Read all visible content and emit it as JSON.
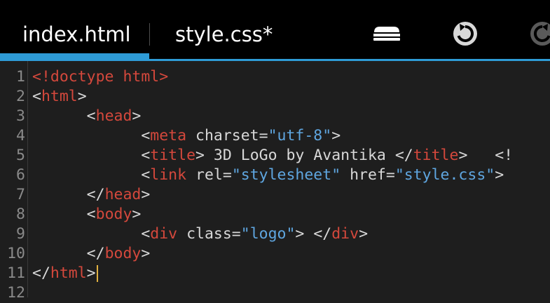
{
  "tabs": [
    {
      "label": "index.html",
      "active": true
    },
    {
      "label": "style.css*",
      "active": false
    }
  ],
  "toolbar": {
    "icons": [
      "menu-icon",
      "undo-icon",
      "redo-icon"
    ]
  },
  "colors": {
    "accent": "#2e9bd6",
    "tag": "#d4483c",
    "string": "#5fa6e0",
    "text": "#d8d8d8",
    "gutter_text": "#8a8a8a",
    "cursor": "#e0b040"
  },
  "editor": {
    "line_numbers": [
      "1",
      "2",
      "3",
      "4",
      "5",
      "6",
      "7",
      "8",
      "9",
      "10",
      "11",
      "12"
    ],
    "lines": [
      {
        "indent": "",
        "tokens": [
          {
            "type": "doctype",
            "text": "<!doctype html>"
          }
        ]
      },
      {
        "indent": "",
        "tokens": [
          {
            "type": "bracket",
            "text": "<"
          },
          {
            "type": "tag",
            "text": "html"
          },
          {
            "type": "bracket",
            "text": ">"
          }
        ]
      },
      {
        "indent": "      ",
        "tokens": [
          {
            "type": "bracket",
            "text": "<"
          },
          {
            "type": "tag",
            "text": "head"
          },
          {
            "type": "bracket",
            "text": ">"
          }
        ]
      },
      {
        "indent": "            ",
        "tokens": [
          {
            "type": "bracket",
            "text": "<"
          },
          {
            "type": "tag",
            "text": "meta"
          },
          {
            "type": "attr",
            "text": " charset="
          },
          {
            "type": "str",
            "text": "\"utf-8\""
          },
          {
            "type": "bracket",
            "text": ">"
          }
        ]
      },
      {
        "indent": "            ",
        "tokens": [
          {
            "type": "bracket",
            "text": "<"
          },
          {
            "type": "tag",
            "text": "title"
          },
          {
            "type": "bracket",
            "text": ">"
          },
          {
            "type": "text",
            "text": " 3D LoGo by Avantika "
          },
          {
            "type": "bracket",
            "text": "</"
          },
          {
            "type": "tag",
            "text": "title"
          },
          {
            "type": "bracket",
            "text": ">"
          },
          {
            "type": "text",
            "text": "   "
          },
          {
            "type": "bracket",
            "text": "<!"
          }
        ]
      },
      {
        "indent": "            ",
        "tokens": [
          {
            "type": "bracket",
            "text": "<"
          },
          {
            "type": "tag",
            "text": "link"
          },
          {
            "type": "attr",
            "text": " rel="
          },
          {
            "type": "str",
            "text": "\"stylesheet\""
          },
          {
            "type": "attr",
            "text": " href="
          },
          {
            "type": "str",
            "text": "\"style.css\""
          },
          {
            "type": "bracket",
            "text": ">"
          }
        ]
      },
      {
        "indent": "      ",
        "tokens": [
          {
            "type": "bracket",
            "text": "</"
          },
          {
            "type": "tag",
            "text": "head"
          },
          {
            "type": "bracket",
            "text": ">"
          }
        ]
      },
      {
        "indent": "      ",
        "tokens": [
          {
            "type": "bracket",
            "text": "<"
          },
          {
            "type": "tag",
            "text": "body"
          },
          {
            "type": "bracket",
            "text": ">"
          }
        ]
      },
      {
        "indent": "            ",
        "tokens": [
          {
            "type": "bracket",
            "text": "<"
          },
          {
            "type": "tag",
            "text": "div"
          },
          {
            "type": "attr",
            "text": " class="
          },
          {
            "type": "str",
            "text": "\"logo\""
          },
          {
            "type": "bracket",
            "text": ">"
          },
          {
            "type": "text",
            "text": " "
          },
          {
            "type": "bracket",
            "text": "</"
          },
          {
            "type": "tag",
            "text": "div"
          },
          {
            "type": "bracket",
            "text": ">"
          }
        ]
      },
      {
        "indent": "      ",
        "tokens": [
          {
            "type": "bracket",
            "text": "</"
          },
          {
            "type": "tag",
            "text": "body"
          },
          {
            "type": "bracket",
            "text": ">"
          }
        ]
      },
      {
        "indent": "",
        "tokens": [
          {
            "type": "bracket",
            "text": "</"
          },
          {
            "type": "tag",
            "text": "html"
          },
          {
            "type": "bracket",
            "text": ">"
          }
        ],
        "cursor": true
      },
      {
        "indent": "",
        "tokens": []
      }
    ]
  }
}
